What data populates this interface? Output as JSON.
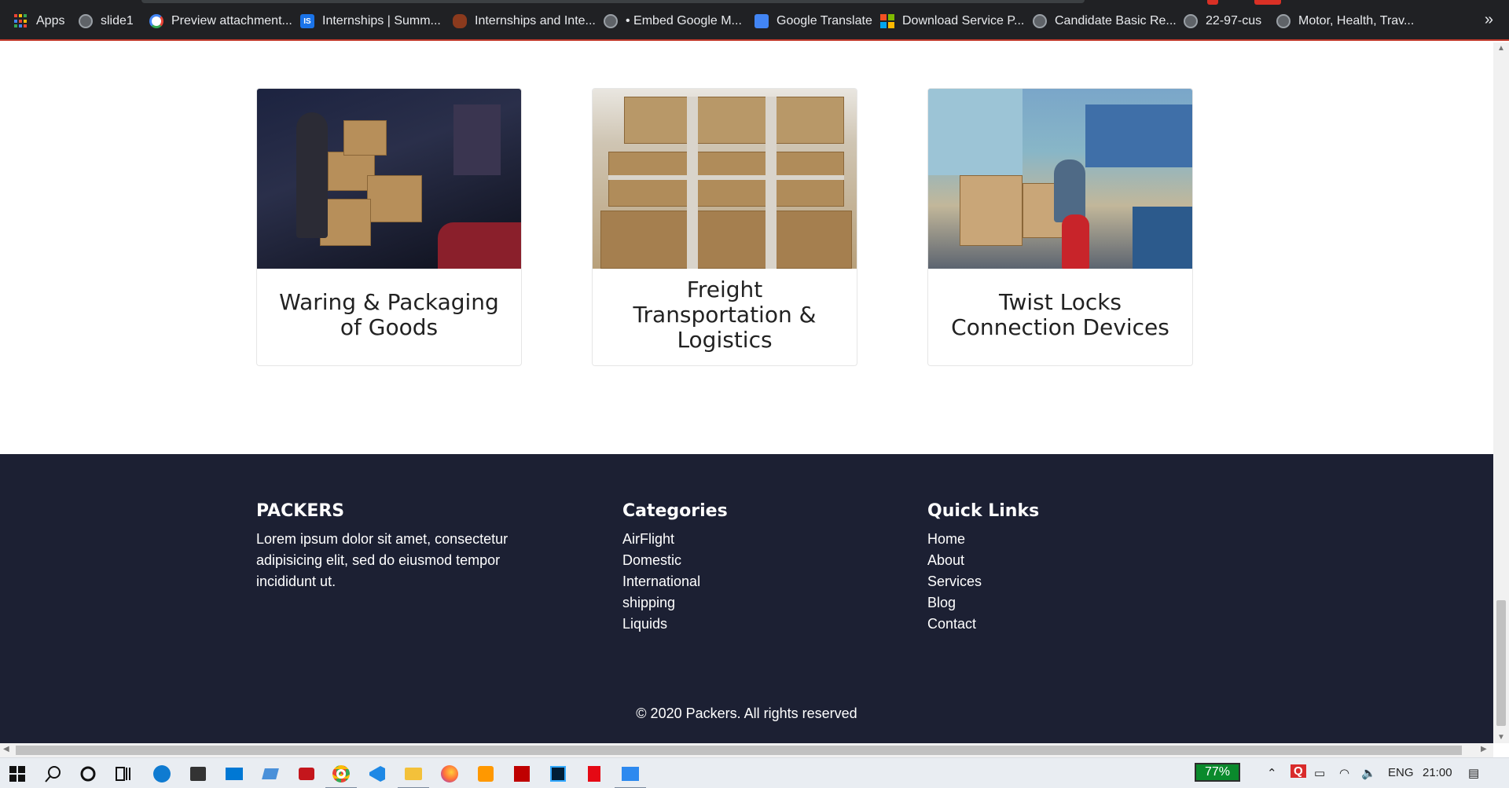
{
  "bookmarks": [
    {
      "label": "Apps",
      "icon": "apps-grid-icon"
    },
    {
      "label": "slide1",
      "icon": "globe-icon"
    },
    {
      "label": "Preview attachment...",
      "icon": "google-icon"
    },
    {
      "label": "Internships | Summ...",
      "icon": "is-icon"
    },
    {
      "label": "Internships and Inte...",
      "icon": "fire-icon"
    },
    {
      "label": "• Embed Google M...",
      "icon": "globe-icon"
    },
    {
      "label": "Google Translate",
      "icon": "translate-icon"
    },
    {
      "label": "Download Service P...",
      "icon": "microsoft-icon"
    },
    {
      "label": "Candidate Basic Re...",
      "icon": "globe-icon"
    },
    {
      "label": "22-97-cus",
      "icon": "globe-icon"
    },
    {
      "label": "Motor, Health, Trav...",
      "icon": "globe-icon"
    }
  ],
  "bookmarks_more": "»",
  "services": [
    {
      "title": "Waring & Packaging of Goods"
    },
    {
      "title": "Freight Transportation & Logistics"
    },
    {
      "title": "Twist Locks Connection Devices"
    }
  ],
  "footer": {
    "brand": {
      "heading": "PACKERS",
      "text": "Lorem ipsum dolor sit amet, consectetur adipisicing elit, sed do eiusmod tempor incididunt ut."
    },
    "categories": {
      "heading": "Categories",
      "items": [
        "AirFlight",
        "Domestic",
        "International",
        "shipping",
        "Liquids"
      ]
    },
    "quick_links": {
      "heading": "Quick Links",
      "items": [
        "Home",
        "About",
        "Services",
        "Blog",
        "Contact"
      ]
    },
    "copyright": "© 2020 Packers. All rights reserved"
  },
  "taskbar": {
    "battery": "77%",
    "language": "ENG",
    "time": "21:00"
  },
  "colors": {
    "footer_bg": "#1c2033",
    "bookmarks_bg": "#202124",
    "battery_green": "#0a8a2c"
  }
}
